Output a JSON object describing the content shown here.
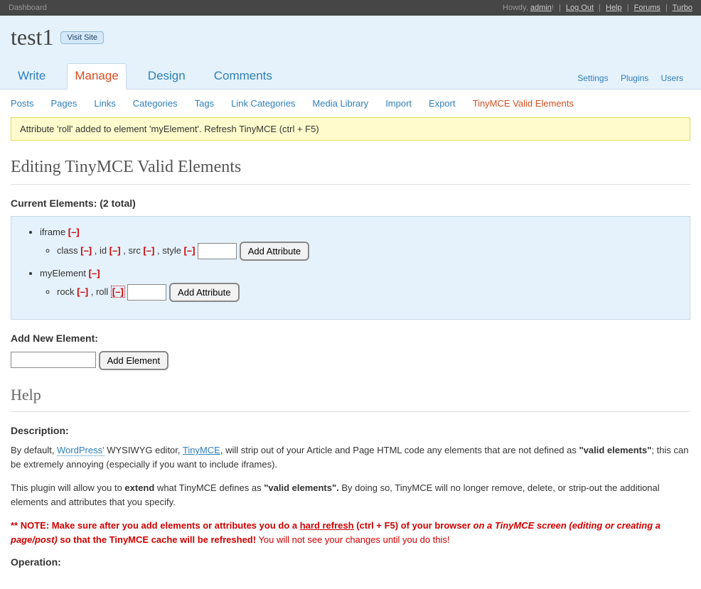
{
  "topbar": {
    "left": "Dashboard",
    "greet": "Howdy,",
    "user": "admin",
    "links": [
      "Log Out",
      "Help",
      "Forums",
      "Turbo"
    ]
  },
  "header": {
    "site_title": "test1",
    "visit_site": "Visit Site"
  },
  "main_tabs": {
    "items": [
      "Write",
      "Manage",
      "Design",
      "Comments"
    ],
    "active_index": 1,
    "right_links": [
      "Settings",
      "Plugins",
      "Users"
    ]
  },
  "subnav": {
    "items": [
      "Posts",
      "Pages",
      "Links",
      "Categories",
      "Tags",
      "Link Categories",
      "Media Library",
      "Import",
      "Export",
      "TinyMCE Valid Elements"
    ],
    "active_index": 9
  },
  "notice": "Attribute 'roll' added to element 'myElement'. Refresh TinyMCE (ctrl + F5)",
  "page_title": "Editing TinyMCE Valid Elements",
  "current_elements_label": "Current Elements: (2 total)",
  "elements": [
    {
      "name": "iframe",
      "attrs": [
        "class",
        "id",
        "src",
        "style"
      ]
    },
    {
      "name": "myElement",
      "attrs": [
        "rock",
        "roll"
      ]
    }
  ],
  "remove_marker": "[–]",
  "add_attribute_btn": "Add Attribute",
  "add_new_element_label": "Add New Element:",
  "add_element_btn": "Add Element",
  "help": {
    "title": "Help",
    "description_label": "Description:",
    "p1_pre": "By default, ",
    "p1_link1": "WordPress'",
    "p1_mid1": " WYSIWYG editor, ",
    "p1_link2": "TinyMCE",
    "p1_mid2": ", will strip out of your Article and Page HTML code any elements that are not defined as ",
    "p1_bold": "\"valid elements\"",
    "p1_tail": "; this can be extremely annoying (especially if you want to include iframes).",
    "p2_pre": "This plugin will allow you to ",
    "p2_b1": "extend",
    "p2_mid": " what TinyMCE defines as ",
    "p2_b2": "\"valid elements\".",
    "p2_tail": " By doing so, TinyMCE will no longer remove, delete, or strip-out the additional elements and attributes that you specify.",
    "note_prefix": "** NOTE: Make sure after you add elements or attributes you do a ",
    "note_link": "hard refresh",
    "note_mid": " (ctrl + F5) of your browser ",
    "note_italic": "on a TinyMCE screen (editing or creating a page/post)",
    "note_tail_bold": " so that the TinyMCE cache will be refreshed!",
    "note_tail_normal": " You will not see your changes until you do this!",
    "operation_label": "Operation:"
  }
}
